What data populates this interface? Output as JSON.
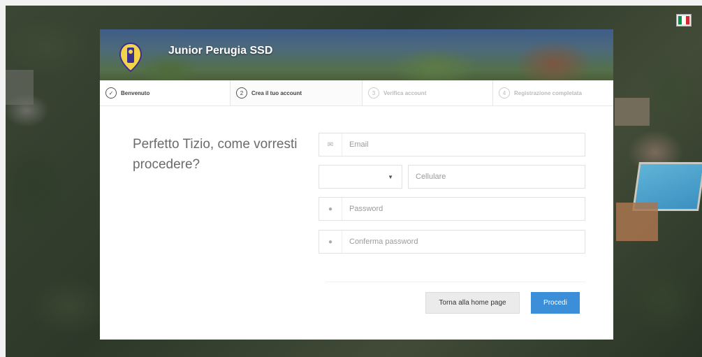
{
  "header": {
    "brand": "Junior Perugia SSD"
  },
  "language": {
    "flag_colors": [
      "#009246",
      "#ffffff",
      "#ce2b37"
    ]
  },
  "steps": [
    {
      "number": "✓",
      "label": "Benvenuto",
      "state": "done"
    },
    {
      "number": "2",
      "label": "Crea il tuo account",
      "state": "active"
    },
    {
      "number": "3",
      "label": "Verifica account",
      "state": "pending"
    },
    {
      "number": "4",
      "label": "Registrazione completata",
      "state": "pending"
    }
  ],
  "main": {
    "prompt": "Perfetto Tizio, come vorresti procedere?"
  },
  "form": {
    "email": {
      "placeholder": "Email",
      "value": "",
      "icon": "envelope-icon"
    },
    "country_code": {
      "value": ""
    },
    "phone": {
      "placeholder": "Cellulare",
      "value": ""
    },
    "password": {
      "placeholder": "Password",
      "value": "",
      "icon": "lock-icon"
    },
    "password_confirm": {
      "placeholder": "Conferma password",
      "value": "",
      "icon": "lock-icon"
    }
  },
  "actions": {
    "home_label": "Torna alla home page",
    "proceed_label": "Procedi"
  },
  "colors": {
    "primary": "#3a8fd8",
    "secondary_button": "#ebebeb",
    "logo_yellow": "#f3d34a",
    "logo_purple": "#3b2f8f"
  }
}
